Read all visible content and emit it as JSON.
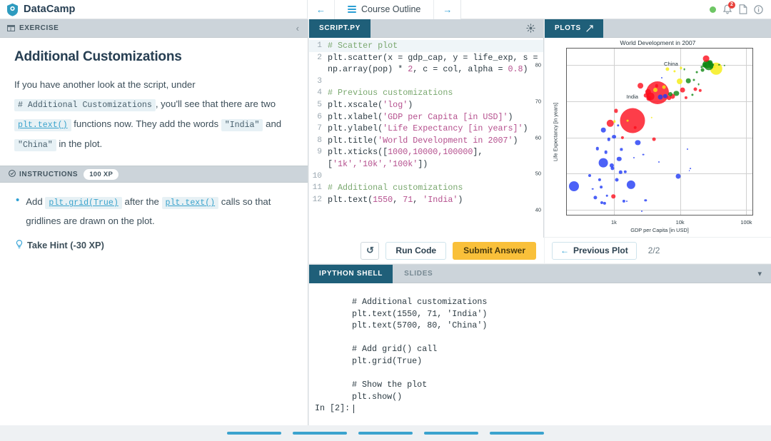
{
  "topbar": {
    "brand": "DataCamp",
    "course_outline_label": "Course Outline",
    "back_arrow": "←",
    "forward_arrow": "→",
    "notification_count": "2"
  },
  "exercise_panel": {
    "tab_label": "EXERCISE",
    "title": "Additional Customizations",
    "paragraph": {
      "p1": "If you have another look at the script, under",
      "code1": "# Additional Customizations",
      "p2": ", you'll see that there are two",
      "code2": "plt.text()",
      "p3": "functions now. They add the words",
      "code3": "\"India\"",
      "p4": "and",
      "code4": "\"China\"",
      "p5": "in the plot."
    },
    "instructions_label": "INSTRUCTIONS",
    "xp_badge": "100 XP",
    "instruction_item": {
      "t1": "Add",
      "code1": "plt.grid(True)",
      "t2": "after the",
      "code2": "plt.text()",
      "t3": "calls so that gridlines are drawn on the plot."
    },
    "hint_label": "Take Hint (-30 XP)"
  },
  "editor": {
    "tab_label": "SCRIPT.PY",
    "lines": [
      {
        "n": "1",
        "highlight": true,
        "tokens": [
          {
            "t": "# Scatter plot",
            "c": "k-com"
          }
        ]
      },
      {
        "n": "2",
        "highlight": false,
        "tokens": [
          {
            "t": "plt.scatter(x = gdp_cap, y = life_exp, s = np.array(pop) * ",
            "c": "k-fn"
          },
          {
            "t": "2",
            "c": "k-num"
          },
          {
            "t": ", c = col, alpha = ",
            "c": "k-fn"
          },
          {
            "t": "0.8",
            "c": "k-num"
          },
          {
            "t": ")",
            "c": "k-fn"
          }
        ]
      },
      {
        "n": "3",
        "highlight": false,
        "tokens": [
          {
            "t": "",
            "c": "k-fn"
          }
        ]
      },
      {
        "n": "4",
        "highlight": false,
        "tokens": [
          {
            "t": "# Previous customizations",
            "c": "k-com"
          }
        ]
      },
      {
        "n": "5",
        "highlight": false,
        "tokens": [
          {
            "t": "plt.xscale(",
            "c": "k-fn"
          },
          {
            "t": "'log'",
            "c": "k-str"
          },
          {
            "t": ")",
            "c": "k-fn"
          }
        ]
      },
      {
        "n": "6",
        "highlight": false,
        "tokens": [
          {
            "t": "plt.xlabel(",
            "c": "k-fn"
          },
          {
            "t": "'GDP per Capita [in USD]'",
            "c": "k-str"
          },
          {
            "t": ")",
            "c": "k-fn"
          }
        ]
      },
      {
        "n": "7",
        "highlight": false,
        "tokens": [
          {
            "t": "plt.ylabel(",
            "c": "k-fn"
          },
          {
            "t": "'Life Expectancy [in years]'",
            "c": "k-str"
          },
          {
            "t": ")",
            "c": "k-fn"
          }
        ]
      },
      {
        "n": "8",
        "highlight": false,
        "tokens": [
          {
            "t": "plt.title(",
            "c": "k-fn"
          },
          {
            "t": "'World Development in 2007'",
            "c": "k-str"
          },
          {
            "t": ")",
            "c": "k-fn"
          }
        ]
      },
      {
        "n": "9",
        "highlight": false,
        "tokens": [
          {
            "t": "plt.xticks([",
            "c": "k-fn"
          },
          {
            "t": "1000,10000,100000",
            "c": "k-num"
          },
          {
            "t": "], [",
            "c": "k-fn"
          },
          {
            "t": "'1k','10k','100k'",
            "c": "k-str"
          },
          {
            "t": "])",
            "c": "k-fn"
          }
        ]
      },
      {
        "n": "10",
        "highlight": false,
        "tokens": [
          {
            "t": "",
            "c": "k-fn"
          }
        ]
      },
      {
        "n": "11",
        "highlight": false,
        "tokens": [
          {
            "t": "# Additional customizations",
            "c": "k-com"
          }
        ]
      },
      {
        "n": "12",
        "highlight": false,
        "tokens": [
          {
            "t": "plt.text(",
            "c": "k-fn"
          },
          {
            "t": "1550",
            "c": "k-num"
          },
          {
            "t": ", ",
            "c": "k-fn"
          },
          {
            "t": "71",
            "c": "k-num"
          },
          {
            "t": ", ",
            "c": "k-fn"
          },
          {
            "t": "'India'",
            "c": "k-str"
          },
          {
            "t": ")",
            "c": "k-fn"
          }
        ]
      }
    ],
    "reset_label": "↺",
    "run_label": "Run Code",
    "submit_label": "Submit Answer"
  },
  "plots": {
    "tab_label": "PLOTS",
    "previous_label": "Previous Plot",
    "counter": "2/2"
  },
  "shell": {
    "tab_ipython": "IPYTHON SHELL",
    "tab_slides": "SLIDES",
    "output_lines": [
      "# Additional customizations",
      "plt.text(1550, 71, 'India')",
      "plt.text(5700, 80, 'China')",
      "",
      "# Add grid() call",
      "plt.grid(True)",
      "",
      "# Show the plot",
      "plt.show()"
    ],
    "prompt": "In [2]:"
  },
  "progress": {
    "segments": 5,
    "color": "#3ba3ce"
  },
  "chart_data": {
    "type": "scatter",
    "title": "World Development in 2007",
    "xlabel": "GDP per Capita [in USD]",
    "ylabel": "Life Expectancy [in years]",
    "xscale": "log",
    "xlim": [
      195,
      130000
    ],
    "ylim": [
      38.3,
      84.5
    ],
    "xticks": [
      1000,
      10000,
      100000
    ],
    "xticklabels": [
      "1k",
      "10k",
      "100k"
    ],
    "yticks": [
      40,
      50,
      60,
      70,
      80
    ],
    "grid": true,
    "legend": "none",
    "annotations": [
      {
        "text": "India",
        "x": 1550,
        "y": 71
      },
      {
        "text": "China",
        "x": 5700,
        "y": 80
      }
    ],
    "colors": {
      "red": "#fc0d1b",
      "blue": "#1f3af5",
      "green": "#0e8712",
      "yellow": "#f5ec0c"
    },
    "note": "Bubble size proportional to population; color encodes continent (red=Asia, blue=Africa, green=Europe, yellow=Americas/Oceania)",
    "points": [
      {
        "x": 250,
        "y": 46.5,
        "r": 7.0,
        "c": "blue"
      },
      {
        "x": 430,
        "y": 49.6,
        "r": 2.0,
        "c": "blue"
      },
      {
        "x": 480,
        "y": 45.8,
        "r": 1.3,
        "c": "blue"
      },
      {
        "x": 520,
        "y": 43.5,
        "r": 2.6,
        "c": "blue"
      },
      {
        "x": 560,
        "y": 56.9,
        "r": 2.2,
        "c": "blue"
      },
      {
        "x": 610,
        "y": 48.3,
        "r": 2.1,
        "c": "blue"
      },
      {
        "x": 640,
        "y": 46.3,
        "r": 1.9,
        "c": "blue"
      },
      {
        "x": 660,
        "y": 42.0,
        "r": 2.0,
        "c": "blue"
      },
      {
        "x": 690,
        "y": 53.0,
        "r": 6.4,
        "c": "blue"
      },
      {
        "x": 700,
        "y": 62.0,
        "r": 3.3,
        "c": "blue"
      },
      {
        "x": 720,
        "y": 41.8,
        "r": 2.1,
        "c": "blue"
      },
      {
        "x": 760,
        "y": 56.0,
        "r": 2.3,
        "c": "blue"
      },
      {
        "x": 790,
        "y": 44.0,
        "r": 1.3,
        "c": "blue"
      },
      {
        "x": 840,
        "y": 59.5,
        "r": 2.2,
        "c": "blue"
      },
      {
        "x": 880,
        "y": 63.9,
        "r": 5.2,
        "c": "red"
      },
      {
        "x": 930,
        "y": 52.2,
        "r": 3.1,
        "c": "blue"
      },
      {
        "x": 960,
        "y": 51.5,
        "r": 2.6,
        "c": "blue"
      },
      {
        "x": 980,
        "y": 43.8,
        "r": 2.8,
        "c": "red"
      },
      {
        "x": 1000,
        "y": 60.2,
        "r": 2.9,
        "c": "blue"
      },
      {
        "x": 1020,
        "y": 64.4,
        "r": 1.8,
        "c": "yellow"
      },
      {
        "x": 1080,
        "y": 67.3,
        "r": 2.6,
        "c": "red"
      },
      {
        "x": 1120,
        "y": 48.3,
        "r": 2.5,
        "c": "blue"
      },
      {
        "x": 1160,
        "y": 63.3,
        "r": 1.7,
        "c": "blue"
      },
      {
        "x": 1200,
        "y": 54.1,
        "r": 3.2,
        "c": "blue"
      },
      {
        "x": 1260,
        "y": 50.4,
        "r": 2.2,
        "c": "blue"
      },
      {
        "x": 1300,
        "y": 56.7,
        "r": 1.6,
        "c": "blue"
      },
      {
        "x": 1350,
        "y": 60.0,
        "r": 2.1,
        "c": "red"
      },
      {
        "x": 1420,
        "y": 42.4,
        "r": 2.1,
        "c": "blue"
      },
      {
        "x": 1480,
        "y": 50.5,
        "r": 2.2,
        "c": "blue"
      },
      {
        "x": 1550,
        "y": 42.5,
        "r": 1.0,
        "c": "blue"
      },
      {
        "x": 1620,
        "y": 64.7,
        "r": 1.4,
        "c": "yellow"
      },
      {
        "x": 1800,
        "y": 46.9,
        "r": 6.1,
        "c": "blue"
      },
      {
        "x": 1900,
        "y": 64.6,
        "r": 17.5,
        "c": "red"
      },
      {
        "x": 2000,
        "y": 54.5,
        "r": 1.0,
        "c": "blue"
      },
      {
        "x": 2100,
        "y": 62.7,
        "r": 2.3,
        "c": "red"
      },
      {
        "x": 2300,
        "y": 58.6,
        "r": 3.6,
        "c": "blue"
      },
      {
        "x": 2500,
        "y": 74.2,
        "r": 3.9,
        "c": "red"
      },
      {
        "x": 2650,
        "y": 39.6,
        "r": 1.0,
        "c": "blue"
      },
      {
        "x": 2800,
        "y": 55.3,
        "r": 1.4,
        "c": "blue"
      },
      {
        "x": 3000,
        "y": 42.7,
        "r": 1.7,
        "c": "blue"
      },
      {
        "x": 3100,
        "y": 71.6,
        "r": 3.3,
        "c": "red"
      },
      {
        "x": 3300,
        "y": 72.6,
        "r": 4.2,
        "c": "red"
      },
      {
        "x": 3400,
        "y": 70.8,
        "r": 3.6,
        "c": "red"
      },
      {
        "x": 3600,
        "y": 71.3,
        "r": 5.4,
        "c": "red"
      },
      {
        "x": 3700,
        "y": 65.5,
        "r": 1.2,
        "c": "yellow"
      },
      {
        "x": 4000,
        "y": 59.5,
        "r": 2.4,
        "c": "red"
      },
      {
        "x": 4200,
        "y": 73.0,
        "r": 3.0,
        "c": "yellow"
      },
      {
        "x": 4400,
        "y": 74.2,
        "r": 2.2,
        "c": "red"
      },
      {
        "x": 4600,
        "y": 72.3,
        "r": 16.0,
        "c": "red"
      },
      {
        "x": 4800,
        "y": 53.3,
        "r": 1.0,
        "c": "blue"
      },
      {
        "x": 5000,
        "y": 71.2,
        "r": 3.5,
        "c": "blue"
      },
      {
        "x": 5300,
        "y": 76.5,
        "r": 1.0,
        "c": "blue"
      },
      {
        "x": 5700,
        "y": 73.8,
        "r": 2.4,
        "c": "yellow"
      },
      {
        "x": 6000,
        "y": 71.4,
        "r": 3.2,
        "c": "blue"
      },
      {
        "x": 6400,
        "y": 78.8,
        "r": 2.6,
        "c": "yellow"
      },
      {
        "x": 6800,
        "y": 70.9,
        "r": 2.8,
        "c": "red"
      },
      {
        "x": 7200,
        "y": 72.0,
        "r": 3.0,
        "c": "green"
      },
      {
        "x": 7700,
        "y": 71.3,
        "r": 3.5,
        "c": "red"
      },
      {
        "x": 8200,
        "y": 78.3,
        "r": 1.6,
        "c": "yellow"
      },
      {
        "x": 8800,
        "y": 72.2,
        "r": 3.6,
        "c": "green"
      },
      {
        "x": 9400,
        "y": 49.3,
        "r": 3.5,
        "c": "blue"
      },
      {
        "x": 9800,
        "y": 75.5,
        "r": 4.0,
        "c": "yellow"
      },
      {
        "x": 10400,
        "y": 79.1,
        "r": 1.6,
        "c": "yellow"
      },
      {
        "x": 11000,
        "y": 73.0,
        "r": 3.4,
        "c": "red"
      },
      {
        "x": 11600,
        "y": 78.8,
        "r": 1.4,
        "c": "green"
      },
      {
        "x": 12200,
        "y": 70.9,
        "r": 2.1,
        "c": "red"
      },
      {
        "x": 12800,
        "y": 56.7,
        "r": 1.0,
        "c": "blue"
      },
      {
        "x": 13400,
        "y": 75.6,
        "r": 3.3,
        "c": "green"
      },
      {
        "x": 13800,
        "y": 50.9,
        "r": 0.9,
        "c": "blue"
      },
      {
        "x": 14200,
        "y": 51.4,
        "r": 0.9,
        "c": "blue"
      },
      {
        "x": 15200,
        "y": 71.8,
        "r": 1.6,
        "c": "green"
      },
      {
        "x": 16000,
        "y": 75.8,
        "r": 1.5,
        "c": "green"
      },
      {
        "x": 17000,
        "y": 73.3,
        "r": 2.5,
        "c": "red"
      },
      {
        "x": 18000,
        "y": 78.0,
        "r": 1.4,
        "c": "green"
      },
      {
        "x": 19000,
        "y": 74.7,
        "r": 1.4,
        "c": "green"
      },
      {
        "x": 20000,
        "y": 72.9,
        "r": 2.2,
        "c": "red"
      },
      {
        "x": 21000,
        "y": 79.4,
        "r": 1.6,
        "c": "green"
      },
      {
        "x": 22000,
        "y": 78.6,
        "r": 2.4,
        "c": "green"
      },
      {
        "x": 23500,
        "y": 79.9,
        "r": 3.2,
        "c": "green"
      },
      {
        "x": 24500,
        "y": 81.7,
        "r": 4.4,
        "c": "red"
      },
      {
        "x": 25500,
        "y": 80.2,
        "r": 5.6,
        "c": "green"
      },
      {
        "x": 27000,
        "y": 79.8,
        "r": 6.6,
        "c": "green"
      },
      {
        "x": 28500,
        "y": 80.6,
        "r": 3.8,
        "c": "green"
      },
      {
        "x": 29500,
        "y": 79.4,
        "r": 2.2,
        "c": "green"
      },
      {
        "x": 31000,
        "y": 80.0,
        "r": 1.8,
        "c": "green"
      },
      {
        "x": 33000,
        "y": 79.4,
        "r": 1.6,
        "c": "yellow"
      },
      {
        "x": 35000,
        "y": 78.9,
        "r": 8.3,
        "c": "yellow"
      },
      {
        "x": 39000,
        "y": 80.0,
        "r": 1.2,
        "c": "green"
      },
      {
        "x": 47000,
        "y": 79.8,
        "r": 1.2,
        "c": "green"
      }
    ]
  }
}
